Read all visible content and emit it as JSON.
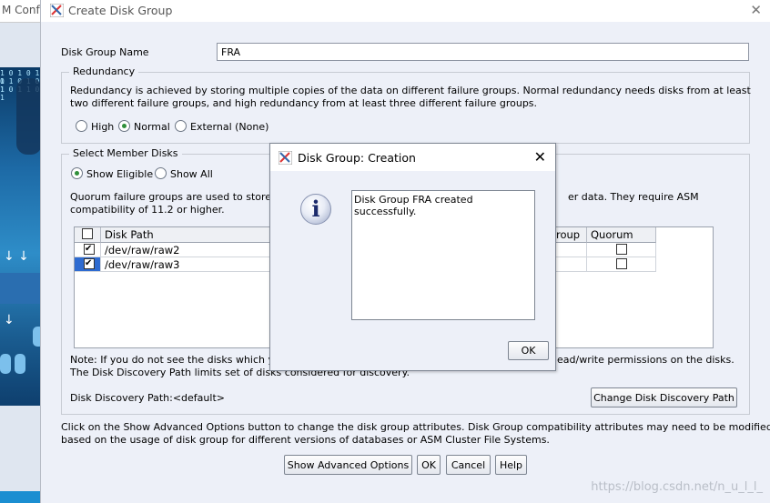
{
  "background": {
    "window_title": "M Conf",
    "art_text": [
      "1 0 1 0 1 1",
      "0 1 0 1 0 1",
      "1 0 1 1 0 1"
    ]
  },
  "dialog": {
    "title": "Create Disk Group",
    "disk_group_name_label": "Disk Group Name",
    "disk_group_name_value": "FRA",
    "redundancy": {
      "legend": "Redundancy",
      "description_line1": "Redundancy is achieved by storing multiple copies of the data on different failure groups. Normal redundancy needs disks from at least",
      "description_line2": "two different failure groups, and high redundancy from at least three different failure groups.",
      "options": [
        "High",
        "Normal",
        "External (None)"
      ],
      "selected": "Normal"
    },
    "member_disks": {
      "legend": "Select Member Disks",
      "filter_options": [
        "Show Eligible",
        "Show All"
      ],
      "filter_selected": "Show Eligible",
      "quorum_text_left": "Quorum failure groups are used to store",
      "quorum_text_right": "er data. They require ASM",
      "quorum_text_line2": "compatibility of 11.2 or higher.",
      "columns": [
        "Disk Path",
        "roup",
        "Quorum"
      ],
      "rows": [
        {
          "path": "/dev/raw/raw2",
          "checked": true,
          "quorum": false
        },
        {
          "path": "/dev/raw/raw3",
          "checked": true,
          "quorum": false
        }
      ],
      "note_line1_left": "Note: If you do not see the disks which yo",
      "note_line1_right": "ead/write permissions on the disks.",
      "note_line2": "The Disk Discovery Path limits set of disks considered for discovery.",
      "discovery_path_label": "Disk Discovery Path:<default>",
      "change_path_button": "Change Disk Discovery Path"
    },
    "advanced_note_line1": "Click on the Show Advanced Options button to change the disk group attributes. Disk Group compatibility attributes may need to be modified",
    "advanced_note_line2": "based on the usage of disk group for different versions of databases or ASM Cluster File Systems.",
    "buttons": {
      "advanced": "Show Advanced Options",
      "ok": "OK",
      "cancel": "Cancel",
      "help": "Help"
    }
  },
  "popup": {
    "title": "Disk Group: Creation",
    "message": "Disk Group FRA created successfully.",
    "ok_button": "OK",
    "icon": "info-icon"
  },
  "watermark": "https://blog.csdn.net/n_u_l_l_",
  "colors": {
    "dialog_bg": "#edf0f8",
    "selection": "#2e6bd1",
    "radio_dot": "#2f8f3a"
  }
}
